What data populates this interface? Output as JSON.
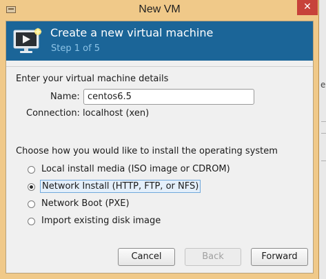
{
  "window": {
    "title": "New VM",
    "close_glyph": "✕"
  },
  "banner": {
    "title": "Create a new virtual machine",
    "subtitle": "Step 1 of 5",
    "icon": "monitor-play-icon",
    "bg_color": "#1b6598",
    "subtitle_color": "#8cc3e6"
  },
  "details": {
    "heading": "Enter your virtual machine details",
    "name_label": "Name:",
    "name_value": "centos6.5",
    "connection_label": "Connection:",
    "connection_value": "localhost (xen)"
  },
  "install": {
    "heading": "Choose how you would like to install the operating system",
    "options": [
      {
        "label": "Local install media (ISO image or CDROM)",
        "selected": false
      },
      {
        "label": "Network Install (HTTP, FTP, or NFS)",
        "selected": true
      },
      {
        "label": "Network Boot (PXE)",
        "selected": false
      },
      {
        "label": "Import existing disk image",
        "selected": false
      }
    ]
  },
  "buttons": {
    "cancel": "Cancel",
    "back": "Back",
    "forward": "Forward"
  },
  "background_fragment": "e"
}
